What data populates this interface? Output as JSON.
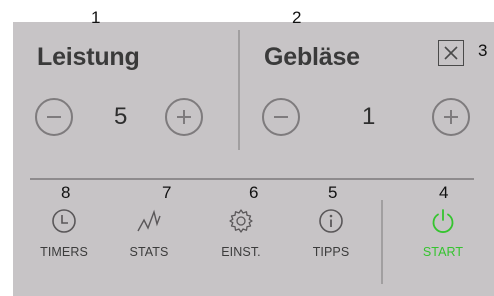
{
  "callouts": [
    "1",
    "2",
    "3",
    "4",
    "5",
    "6",
    "7",
    "8"
  ],
  "power_section": {
    "title": "Leistung",
    "value": "5"
  },
  "fan_section": {
    "title": "Gebläse",
    "value": "1"
  },
  "nav": {
    "timers": "TIMERS",
    "stats": "STATS",
    "settings": "EINST.",
    "tips": "TIPPS",
    "start": "START"
  },
  "colors": {
    "panel": "#c7c4c6",
    "start_green": "#35c42f",
    "icon_gray": "#7e7b7d"
  }
}
